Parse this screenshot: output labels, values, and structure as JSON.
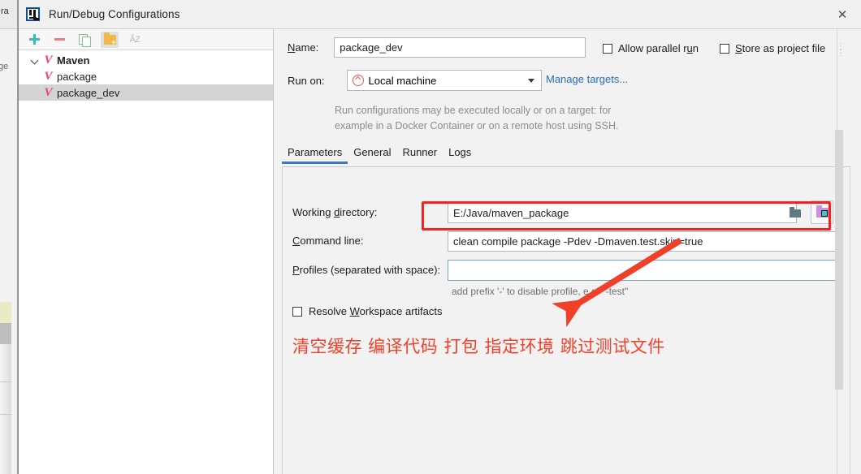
{
  "window": {
    "title": "Run/Debug Configurations",
    "close_label": "✕",
    "app_icon": "intellij-idea-icon"
  },
  "toolbar": {
    "add_label": "+",
    "remove_label": "−",
    "copy_label": "copy-configuration",
    "folder_label": "new-folder",
    "sort_label": "ÂZ"
  },
  "tree": {
    "items": [
      {
        "label": "Maven",
        "level": 0,
        "expanded": true,
        "selected": false,
        "bold": true
      },
      {
        "label": "package",
        "level": 1,
        "expanded": false,
        "selected": false,
        "bold": false
      },
      {
        "label": "package_dev",
        "level": 1,
        "expanded": false,
        "selected": true,
        "bold": false
      }
    ]
  },
  "form": {
    "name_label": "Name:",
    "name_value": "package_dev",
    "allow_parallel_label": "Allow parallel run",
    "allow_parallel_checked": false,
    "store_project_label": "Store as project file",
    "store_project_checked": false,
    "run_on_label": "Run on:",
    "run_on_value": "Local machine",
    "manage_targets_label": "Manage targets...",
    "hint_line1": "Run configurations may be executed locally or on a target: for",
    "hint_line2": "example in a Docker Container or on a remote host using SSH."
  },
  "tabs": [
    {
      "label": "Parameters",
      "active": true
    },
    {
      "label": "General",
      "active": false
    },
    {
      "label": "Runner",
      "active": false
    },
    {
      "label": "Logs",
      "active": false
    }
  ],
  "parameters": {
    "working_directory_label": "Working directory:",
    "working_directory_value": "E:/Java/maven_package",
    "command_line_label": "Command line:",
    "command_line_value": "clean compile package -Pdev -Dmaven.test.skip=true",
    "profiles_label": "Profiles (separated with space):",
    "profiles_value": "",
    "profiles_hint": "add prefix '-' to disable profile, e.g. \"-test\"",
    "resolve_workspace_label": "Resolve Workspace artifacts",
    "resolve_workspace_checked": false,
    "folder_browse_icon": "folder-open-icon",
    "module_browse_icon": "module-folder-icon"
  },
  "annotations": {
    "highlight_color": "#fb2020",
    "text_color": "#f0402a",
    "chinese_note": "清空缓存  编译代码 打包 指定环境  跳过测试文件",
    "arrow_label": "red-arrow-pointing-down-left"
  },
  "background": {
    "frag_a": "ra",
    "frag_b": "ge"
  }
}
